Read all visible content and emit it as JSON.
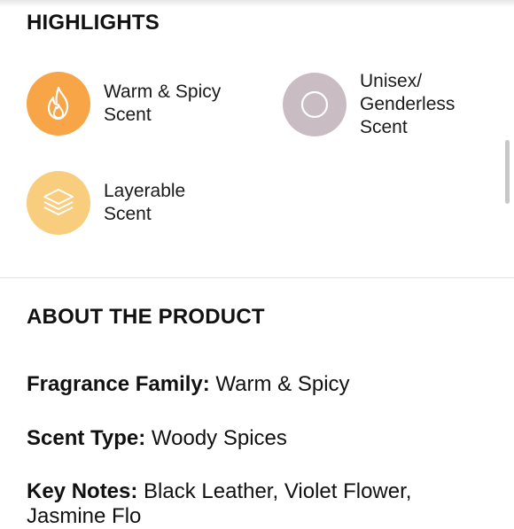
{
  "highlights": {
    "title": "HIGHLIGHTS",
    "items": [
      {
        "label_line1": "Warm & Spicy",
        "label_line2": "Scent",
        "icon": "flame-icon",
        "color": "#f7a547"
      },
      {
        "label_line1": "Unisex/",
        "label_line2": "Genderless",
        "label_line3": "Scent",
        "icon": "circle-icon",
        "color": "#c9bdc3"
      },
      {
        "label_line1": "Layerable",
        "label_line2": "Scent",
        "icon": "layers-icon",
        "color": "#f8cd7e"
      }
    ]
  },
  "about": {
    "title": "ABOUT THE PRODUCT",
    "details": [
      {
        "key": "Fragrance Family:",
        "value": "Warm & Spicy"
      },
      {
        "key": "Scent Type:",
        "value": "Woody Spices"
      },
      {
        "key": "Key Notes:",
        "value": "Black Leather, Violet Flower,",
        "value_line2": "Jasmine Flo"
      }
    ]
  }
}
